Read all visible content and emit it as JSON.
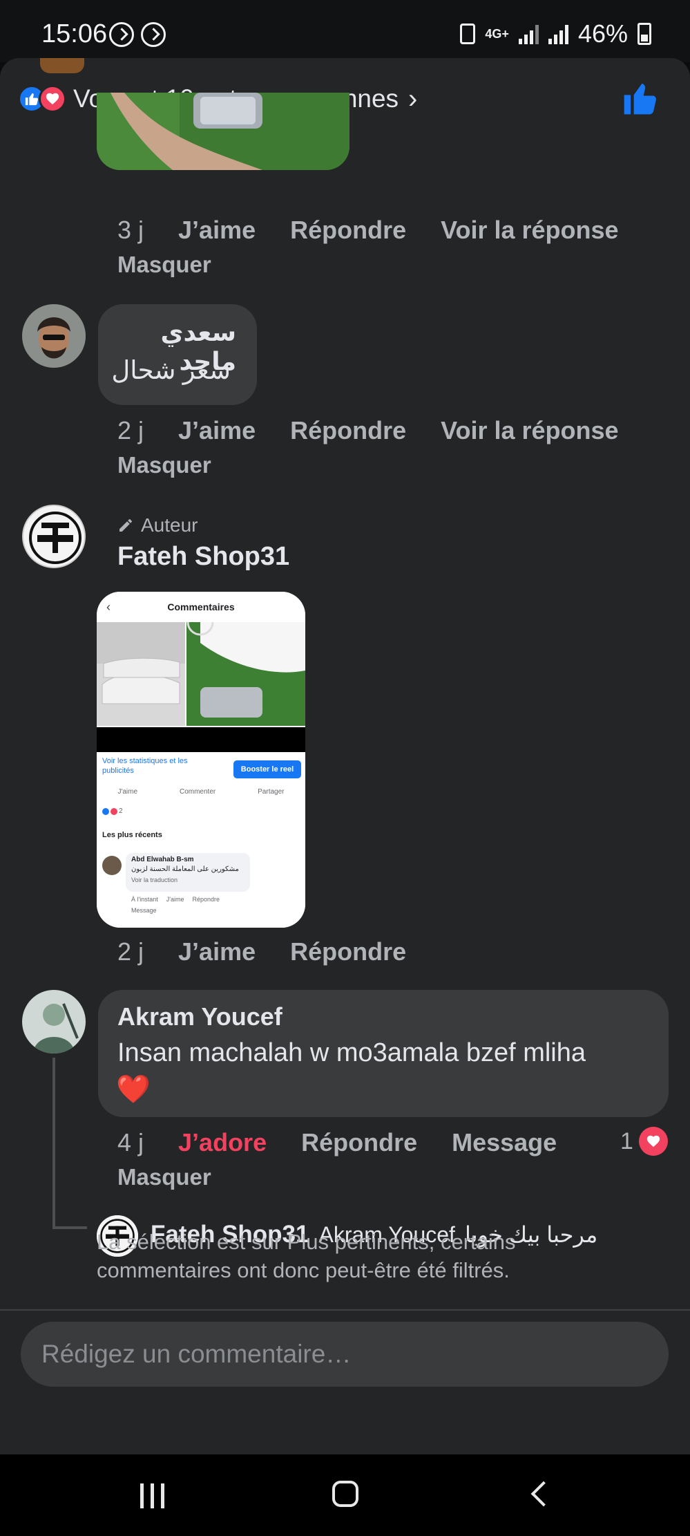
{
  "status_bar": {
    "time": "15:06",
    "network": "4G+",
    "battery": "46%"
  },
  "reactions": {
    "summary": "Vous et 10 autres personnes"
  },
  "comment1": {
    "time": "3 j",
    "like": "J’aime",
    "reply": "Répondre",
    "view_reply": "Voir la réponse",
    "hide": "Masquer"
  },
  "comment2": {
    "name": "سعدي ماجد",
    "text": "سعر شحال",
    "time": "2 j",
    "like": "J’aime",
    "reply": "Répondre",
    "view_reply": "Voir la réponse",
    "hide": "Masquer"
  },
  "comment3": {
    "badge": "Auteur",
    "name": "Fateh Shop31",
    "time": "2 j",
    "like": "J’aime",
    "reply": "Répondre",
    "screenshot": {
      "header": "Commentaires",
      "stats_link": "Voir les statistiques et les publicités",
      "boost_button": "Booster le reel",
      "action_like": "J'aime",
      "action_comment": "Commenter",
      "action_share": "Partager",
      "reaction_count": "2",
      "sort_label": "Les plus récents",
      "commenter_name": "Abd Elwahab B-sm",
      "commenter_text": "مشكورين على المعاملة الحسنة لزبون",
      "translate": "Voir la traduction",
      "meta_time": "À l'instant",
      "meta_like": "J'aime",
      "meta_reply": "Répondre",
      "meta_message": "Message"
    }
  },
  "comment4": {
    "name": "Akram Youcef",
    "text": "Insan machalah w mo3amala bzef mliha",
    "emoji": "❤️",
    "time": "4 j",
    "reaction_label": "J’adore",
    "reply": "Répondre",
    "message": "Message",
    "reaction_count": "1",
    "hide": "Masquer"
  },
  "reply1": {
    "name": "Fateh Shop31",
    "mention": "Akram Youcef",
    "text": "مرحبا بيك خويا"
  },
  "filter_notice": "La sélection est sur Plus pertinents, certains commentaires ont donc peut-être été filtrés.",
  "composer": {
    "placeholder": "Rédigez un commentaire…"
  },
  "colors": {
    "background": "#242526",
    "bubble": "#3a3b3c",
    "accent_blue": "#1877f2",
    "love_red": "#f3425f",
    "muted_text": "#b0b3b8"
  }
}
